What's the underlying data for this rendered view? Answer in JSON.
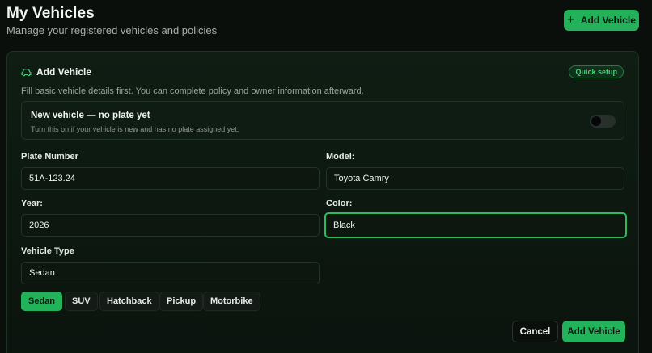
{
  "header": {
    "title": "My Vehicles",
    "subtitle": "Manage your registered vehicles and policies",
    "add_button_label": "Add Vehicle",
    "add_button_icon": "plus-icon"
  },
  "card": {
    "title": "Add Vehicle",
    "title_icon": "car-icon",
    "badge": "Quick setup",
    "description": "Fill basic vehicle details first. You can complete policy and owner information afterward.",
    "new_vehicle_toggle": {
      "title": "New vehicle — no plate yet",
      "hint": "Turn this on if your vehicle is new and has no plate assigned yet.",
      "on": false
    },
    "fields": {
      "plate_label": "Plate Number",
      "plate_value": "51A-123.24",
      "model_label": "Model:",
      "model_value": "Toyota Camry",
      "year_label": "Year:",
      "year_value": "2026",
      "color_label": "Color:",
      "color_value": "Black",
      "type_label": "Vehicle Type",
      "type_value": "Sedan"
    },
    "type_options": [
      "Sedan",
      "SUV",
      "Hatchback",
      "Pickup",
      "Motorbike"
    ],
    "selected_type": "Sedan",
    "cancel_label": "Cancel",
    "submit_label": "Add Vehicle"
  },
  "colors": {
    "accent": "#22b35a",
    "background": "#0b0f0c",
    "card_bg": "#0f1d13",
    "badge_text": "#45d276"
  }
}
